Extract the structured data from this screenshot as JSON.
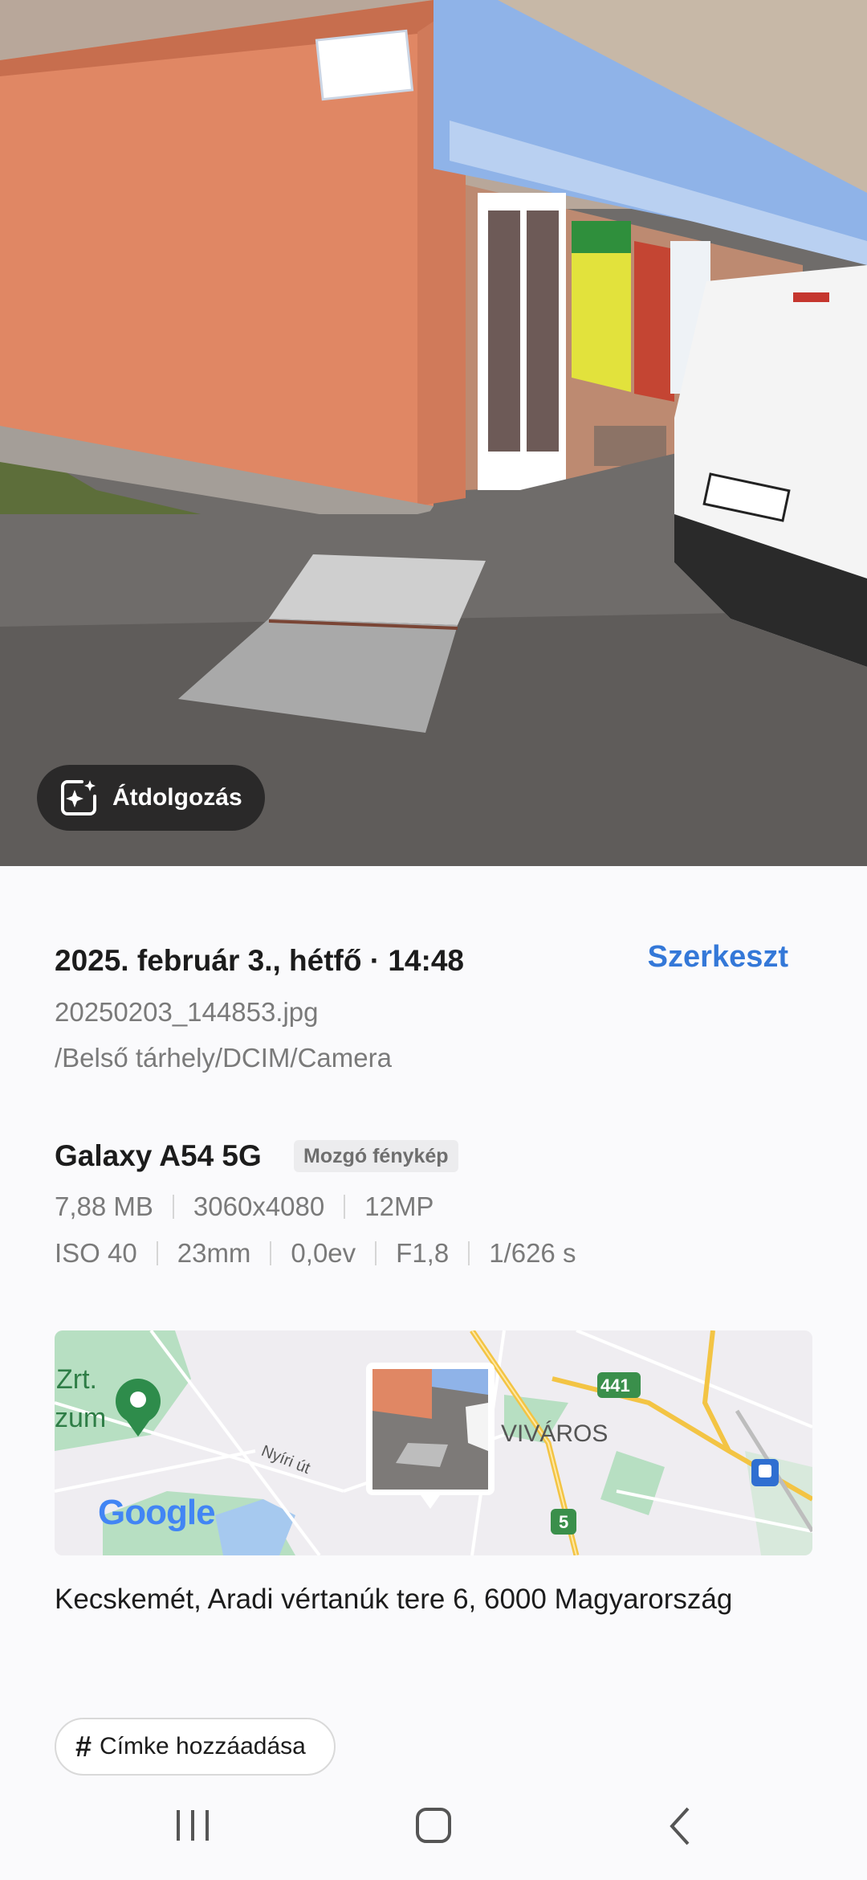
{
  "photo": {
    "remaster_label": "Átdolgozás",
    "icons": {
      "remaster": "sparkle-frame-icon"
    }
  },
  "details": {
    "datetime": "2025. február 3., hétfő · 14:48",
    "edit_label": "Szerkeszt",
    "filename": "20250203_144853.jpg",
    "path": "/Belső tárhely/DCIM/Camera",
    "device": "Galaxy A54 5G",
    "badge": "Mozgó fénykép",
    "specs_row1": [
      "7,88 MB",
      "3060x4080",
      "12MP"
    ],
    "specs_row2": [
      "ISO 40",
      "23mm",
      "0,0ev",
      "F1,8",
      "1/626 s"
    ]
  },
  "map": {
    "labels": {
      "place_left_1": "Zrt.",
      "place_left_2": "zum",
      "street": "Nyíri út",
      "district": "VIVÁROS",
      "route_441": "441",
      "route_5": "5",
      "brand": "Google"
    },
    "colors": {
      "road": "#f3c444",
      "park": "#b7dfc2",
      "water": "#a6c9ef"
    }
  },
  "location": {
    "address": "Kecskemét, Aradi vértanúk tere 6, 6000 Magyarország"
  },
  "tag": {
    "label": "Címke hozzáadása"
  },
  "navbar": {
    "icons": [
      "recents-icon",
      "home-icon",
      "back-icon"
    ]
  },
  "colors": {
    "accent": "#3478d8"
  }
}
